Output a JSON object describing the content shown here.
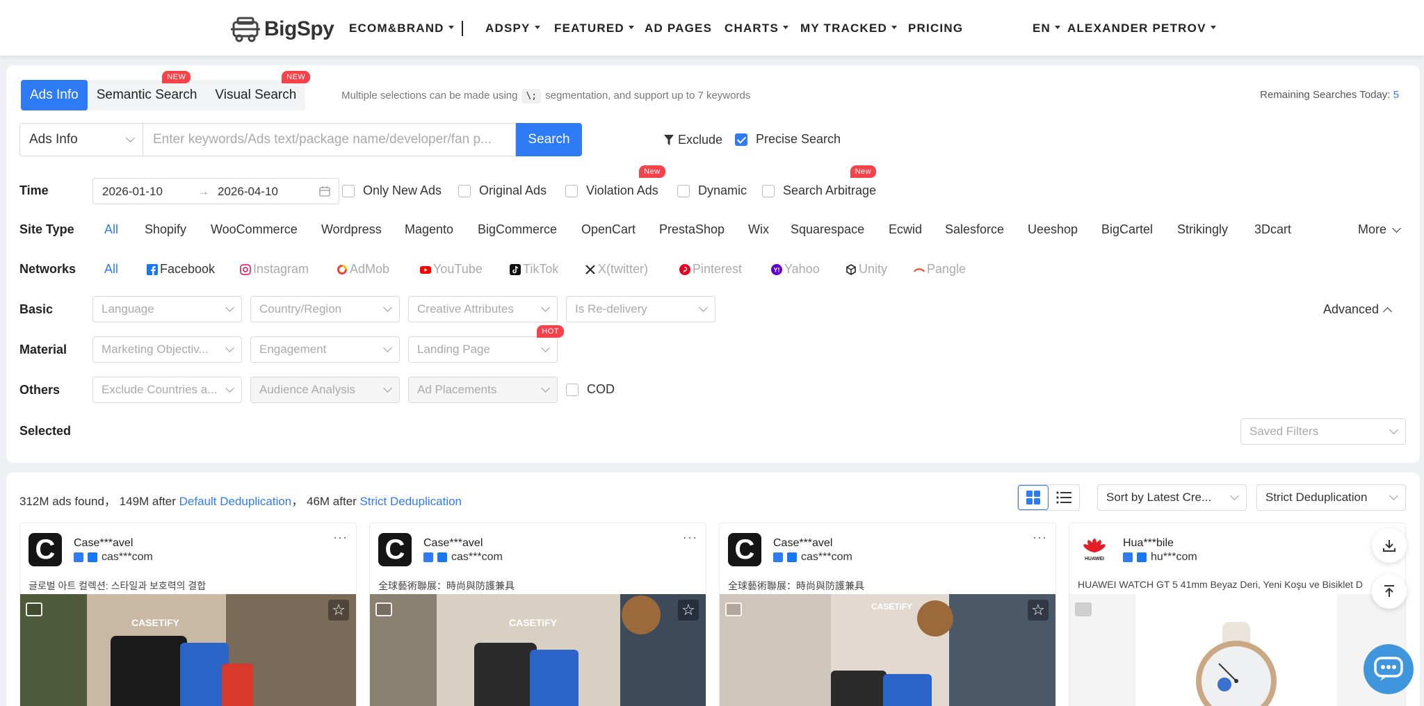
{
  "nav": {
    "logo": "BigSpy",
    "items": [
      {
        "label": "ECOM&BRAND",
        "dropdown": true
      },
      {
        "label": "ADSPY",
        "dropdown": true
      },
      {
        "label": "FEATURED",
        "dropdown": true
      },
      {
        "label": "AD PAGES",
        "dropdown": false
      },
      {
        "label": "CHARTS",
        "dropdown": true
      },
      {
        "label": "MY TRACKED",
        "dropdown": true
      },
      {
        "label": "PRICING",
        "dropdown": false
      }
    ],
    "language": "EN",
    "user": "ALEXANDER PETROV"
  },
  "tabs": [
    {
      "label": "Ads Info",
      "active": true,
      "badge": ""
    },
    {
      "label": "Semantic Search",
      "active": false,
      "badge": "NEW"
    },
    {
      "label": "Visual Search",
      "active": false,
      "badge": "NEW"
    }
  ],
  "hint": {
    "before": "Multiple selections can be made using",
    "key": "\\;",
    "after": "segmentation, and support up to 7 keywords"
  },
  "remaining": {
    "label": "Remaining Searches Today:",
    "value": "5"
  },
  "search": {
    "type": "Ads Info",
    "placeholder": "Enter keywords/Ads text/package name/developer/fan p...",
    "button": "Search",
    "exclude": "Exclude",
    "precise": "Precise Search",
    "precise_checked": true
  },
  "time": {
    "label": "Time",
    "start": "2026-01-10",
    "end": "2026-04-10",
    "options": [
      {
        "label": "Only New Ads",
        "badge": ""
      },
      {
        "label": "Original Ads",
        "badge": ""
      },
      {
        "label": "Violation Ads",
        "badge": "New"
      },
      {
        "label": "Dynamic",
        "badge": ""
      },
      {
        "label": "Search Arbitrage",
        "badge": "New"
      }
    ]
  },
  "site_type": {
    "label": "Site Type",
    "items": [
      "All",
      "Shopify",
      "WooCommerce",
      "Wordpress",
      "Magento",
      "BigCommerce",
      "OpenCart",
      "PrestaShop",
      "Wix",
      "Squarespace",
      "Ecwid",
      "Salesforce",
      "Ueeshop",
      "BigCartel",
      "Strikingly",
      "3Dcart"
    ],
    "more": "More"
  },
  "networks": {
    "label": "Networks",
    "items": [
      {
        "label": "All",
        "icon": ""
      },
      {
        "label": "Facebook",
        "icon": "facebook-icon"
      },
      {
        "label": "Instagram",
        "icon": "instagram-icon"
      },
      {
        "label": "AdMob",
        "icon": "admob-icon"
      },
      {
        "label": "YouTube",
        "icon": "youtube-icon"
      },
      {
        "label": "TikTok",
        "icon": "tiktok-icon"
      },
      {
        "label": "X(twitter)",
        "icon": "x-icon"
      },
      {
        "label": "Pinterest",
        "icon": "pinterest-icon"
      },
      {
        "label": "Yahoo",
        "icon": "yahoo-icon"
      },
      {
        "label": "Unity",
        "icon": "unity-icon"
      },
      {
        "label": "Pangle",
        "icon": "pangle-icon"
      }
    ]
  },
  "basic": {
    "label": "Basic",
    "filters": [
      "Language",
      "Country/Region",
      "Creative Attributes",
      "Is Re-delivery"
    ],
    "advanced": "Advanced"
  },
  "material": {
    "label": "Material",
    "filters": [
      "Marketing Objectiv...",
      "Engagement",
      "Landing Page"
    ],
    "badge": "HOT"
  },
  "others": {
    "label": "Others",
    "filters": [
      "Exclude Countries a...",
      "Audience Analysis",
      "Ad Placements"
    ],
    "cod": "COD"
  },
  "selected": {
    "label": "Selected",
    "saved_filters": "Saved Filters"
  },
  "results": {
    "total": "312M ads found，",
    "default_count": "149M after ",
    "default_link": "Default Deduplication",
    "sep": "，",
    "strict_count": "46M after ",
    "strict_link": "Strict Deduplication",
    "sort": "Sort by Latest Cre...",
    "dedup": "Strict Deduplication"
  },
  "cards": [
    {
      "name": "Case***avel",
      "domain": "cas***com",
      "text": "글로벌 아트 컬렉션: 스타일과 보호력의 결합",
      "avatar": "C"
    },
    {
      "name": "Case***avel",
      "domain": "cas***com",
      "text": "全球藝術聯展：時尚與防護兼具",
      "avatar": "C"
    },
    {
      "name": "Case***avel",
      "domain": "cas***com",
      "text": "全球藝術聯展：時尚與防護兼具",
      "avatar": "C"
    },
    {
      "name": "Hua***bile",
      "domain": "hu***com",
      "text": "HUAWEI WATCH GT 5 41mm Beyaz Deri, Yeni Koşu ve Bisiklet D",
      "avatar": "HUAWEI"
    }
  ],
  "colors": {
    "accent": "#2f7bf6",
    "badge": "#f5424b"
  }
}
